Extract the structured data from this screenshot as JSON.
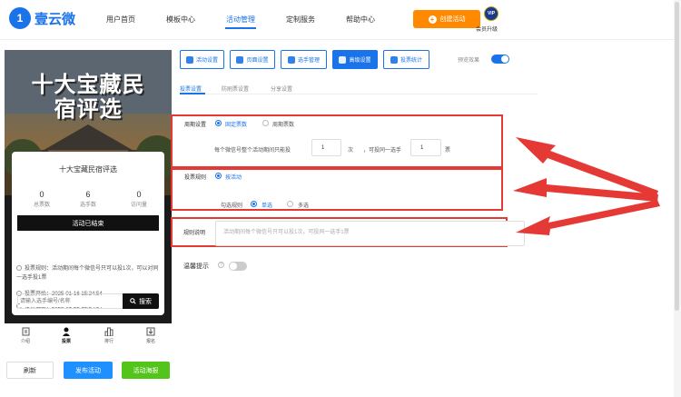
{
  "brand": {
    "logo_mark": "1",
    "name": "壹云微"
  },
  "nav": [
    {
      "label": "用户首页"
    },
    {
      "label": "模板中心"
    },
    {
      "label": "活动管理"
    },
    {
      "label": "定制服务"
    },
    {
      "label": "帮助中心"
    }
  ],
  "header": {
    "create_label": "创建活动",
    "vip_badge": "VIP",
    "vip_label": "会员升级"
  },
  "preview": {
    "poster_title_line1": "十大宝藏民",
    "poster_title_line2": "宿评选",
    "card_title": "十大宝藏民宿评选",
    "stats": [
      {
        "value": "0",
        "label": "总票数"
      },
      {
        "value": "6",
        "label": "选手数"
      },
      {
        "value": "0",
        "label": "访问量"
      }
    ],
    "status": "活动已结束",
    "start": "投票开始：2025-01-16 15:24:54",
    "end": "投票截止：2025-01-22 15:24:54",
    "rule": "投票规则：活动期间每个微信号只可以投1次，可以对同一选手投1票",
    "search_placeholder": "请输入选手编号/名称",
    "search_button": "搜索",
    "tabs": [
      {
        "label": "介绍",
        "icon": "document-icon"
      },
      {
        "label": "投票",
        "icon": "person-icon"
      },
      {
        "label": "排行",
        "icon": "ranking-icon"
      },
      {
        "label": "报名",
        "icon": "download-icon"
      }
    ]
  },
  "actions": {
    "refresh": "刷新",
    "publish": "发布活动",
    "poster": "活动海报"
  },
  "settings_tabs": [
    {
      "label": "活动设置",
      "icon": "gear-icon"
    },
    {
      "label": "页面设置",
      "icon": "gear-icon"
    },
    {
      "label": "选手管理",
      "icon": "users-icon"
    },
    {
      "label": "高级设置",
      "icon": "sliders-icon"
    },
    {
      "label": "投票统计",
      "icon": "bar-chart-icon"
    }
  ],
  "preview_effect": {
    "label": "预览效果",
    "on": true
  },
  "sub_tabs": [
    {
      "label": "投票设置"
    },
    {
      "label": "防刷票设置"
    },
    {
      "label": "分享设置"
    }
  ],
  "form": {
    "cycle": {
      "label": "周期设置",
      "options": [
        "固定票数",
        "周期票数"
      ],
      "selected": 0,
      "text_before": "每个微信号整个活动期间只能投",
      "votes_value": "1",
      "unit1": "次",
      "text_mid": "，可投同一选手",
      "same_value": "1",
      "unit2": "票"
    },
    "rule": {
      "label": "投票规则",
      "option": "按活动",
      "check_label": "勾选规则",
      "check_options": [
        "单选",
        "多选"
      ],
      "check_selected": 0
    },
    "description": {
      "label": "规则说明",
      "placeholder": "活动期间每个微信号只可以投1次，可投同一选手1票"
    },
    "tip": {
      "label": "温馨提示",
      "help": "?",
      "on": false
    }
  },
  "colors": {
    "primary": "#1a73e8",
    "orange": "#ff8a00",
    "green": "#52c41a",
    "red": "#e53935"
  }
}
